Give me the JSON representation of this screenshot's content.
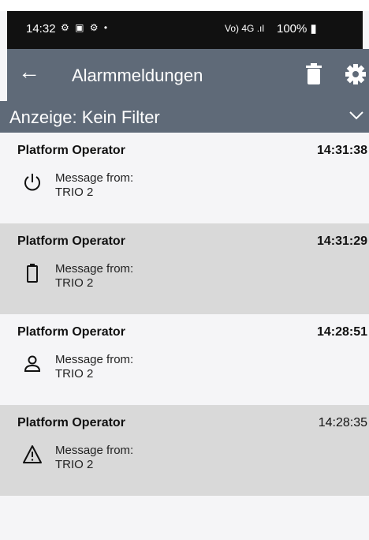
{
  "status_bar": {
    "time": "14:32",
    "left_icons": "⚙ ▣ ⚙ •",
    "right_icons": "Vo) 4G .ıl",
    "battery": "100%"
  },
  "app_bar": {
    "title": "Alarmmeldungen",
    "back_icon": "arrow-left",
    "actions": [
      "trash-icon",
      "gear-icon"
    ]
  },
  "filter": {
    "label": "Anzeige: Kein Filter"
  },
  "alarms": [
    {
      "title": "Platform Operator",
      "time": "14:31:38",
      "icon": "power-icon",
      "message_line1": "Message from:",
      "message_line2": "TRIO 2",
      "background": "#f5f5f7"
    },
    {
      "title": "Platform Operator",
      "time": "14:31:29",
      "icon": "battery-icon",
      "message_line1": "Message from:",
      "message_line2": "TRIO 2",
      "background": "#d9d9d9"
    },
    {
      "title": "Platform Operator",
      "time": "14:28:51",
      "icon": "person-icon",
      "message_line1": "Message from:",
      "message_line2": "TRIO 2",
      "background": "#f5f5f7"
    },
    {
      "title": "Platform Operator",
      "time": "14:28:35",
      "icon": "warning-icon",
      "message_line1": "Message from:",
      "message_line2": "TRIO 2",
      "background": "#d9d9d9"
    }
  ],
  "colors": {
    "appbar": "#5f6a78",
    "statusbar": "#111111",
    "row_light": "#f5f5f7",
    "row_dark": "#d9d9d9"
  }
}
